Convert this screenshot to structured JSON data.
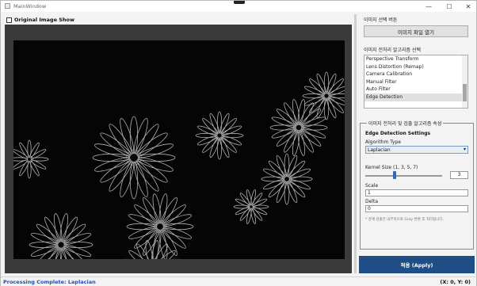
{
  "window": {
    "title": "MainWindow",
    "minimize_glyph": "—",
    "maximize_glyph": "☐",
    "close_glyph": "✕"
  },
  "left": {
    "checkbox_label": "Original Image Show",
    "checkbox_checked": false,
    "image_description_icon": "edge-detected-flowers-image"
  },
  "right": {
    "file_section_caption": "이미지 선택 버튼",
    "open_button_label": "이미지 파일 열기",
    "algo_section_caption": "이미지 전처리 알고리즘 선택",
    "algorithms": [
      "Perspective Transform",
      "Lens Distortion (Remap)",
      "Camera Calibration",
      "Manual Filter",
      "Auto Filter",
      "Edge Detection"
    ],
    "selected_algorithm": "Edge Detection",
    "group_title": "이미지 전처리 및 검출 알고리즘 속성",
    "settings_heading": "Edge Detection Settings",
    "algorithm_type_label": "Algorithm Type",
    "algorithm_type_value": "Laplacian",
    "kernel_label": "Kernel Size (1, 3, 5, 7)",
    "kernel_value": "3",
    "scale_label": "Scale",
    "scale_value": "1",
    "delta_label": "Delta",
    "delta_value": "0",
    "note": "* 경계 검출은 내부적으로 Gray 변환 후 처리됩니다.",
    "apply_label": "적용 (Apply)",
    "accent_color": "#1f4e86"
  },
  "status": {
    "message": "Processing Complete: Laplacian",
    "coordinates": "(X: 0, Y: 0)",
    "message_color": "#1a4fc4"
  }
}
